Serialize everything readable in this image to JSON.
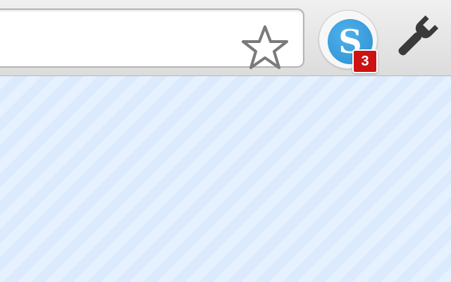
{
  "omnibox": {
    "value": "",
    "placeholder": "",
    "bookmark_icon": "star-icon"
  },
  "extension": {
    "logo_letter": "S",
    "badge_count": "3",
    "logo_color": "#3aa0e0",
    "badge_color": "#cc1212"
  },
  "menu": {
    "icon": "wrench-icon"
  },
  "page": {
    "background_color": "#e3f0fe"
  }
}
